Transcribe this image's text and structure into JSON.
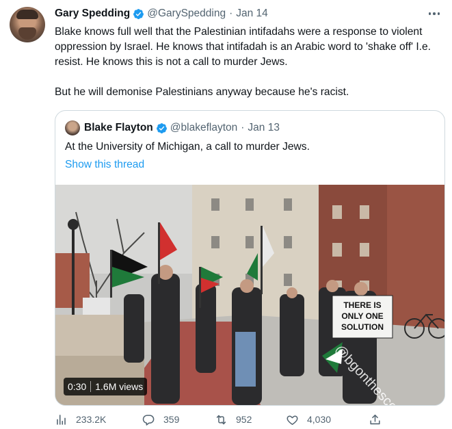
{
  "tweet": {
    "author": {
      "name": "Gary Spedding",
      "handle": "@GarySpedding",
      "date": "Jan 14"
    },
    "text_p1": "Blake knows full well that the Palestinian intifadahs were a response to violent oppression by Israel. He knows that intifadah is an Arabic word to 'shake off' I.e. resist. He knows this is not a call to murder Jews.",
    "text_p2": "But he will demonise Palestinians anyway because he's racist."
  },
  "quoted": {
    "author": {
      "name": "Blake Flayton",
      "handle": "@blakeflayton",
      "date": "Jan 13"
    },
    "text": "At the University of Michigan, a call to murder Jews.",
    "thread_link": "Show this thread",
    "media": {
      "duration": "0:30",
      "views": "1.6M views",
      "sign_text": "THERE IS ONLY ONE SOLUTION",
      "watermark": "@bgonthescene"
    }
  },
  "actions": {
    "views": "233.2K",
    "replies": "359",
    "retweets": "952",
    "likes": "4,030"
  },
  "icons": [
    "views-icon",
    "reply-icon",
    "retweet-icon",
    "like-icon",
    "share-icon",
    "more-icon",
    "verified-badge-icon"
  ],
  "colors": {
    "accent": "#1d9bf0",
    "muted": "#536471",
    "text": "#0f1419",
    "border": "#cfd9de"
  }
}
